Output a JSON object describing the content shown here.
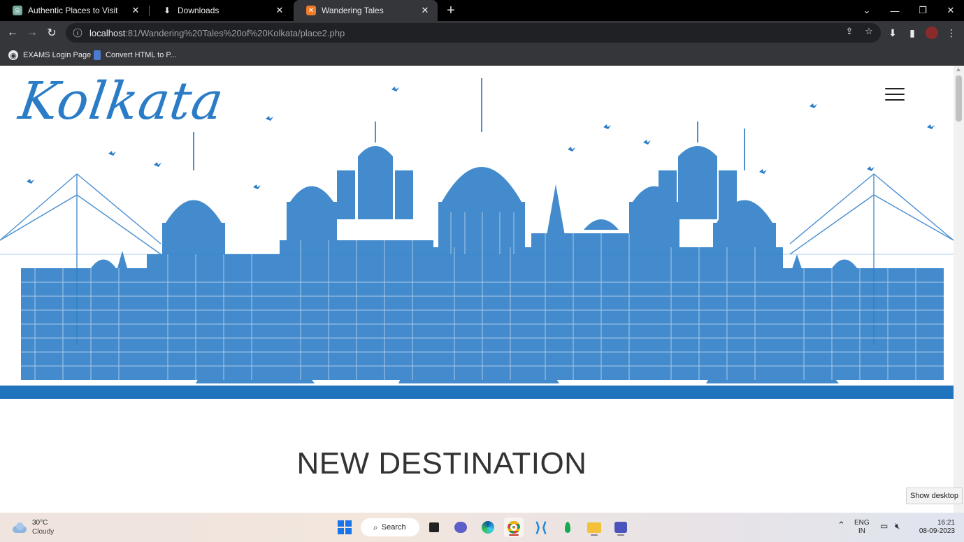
{
  "browser": {
    "tabs": [
      {
        "title": "Authentic Places to Visit",
        "icon": "gpt-icon",
        "active": false
      },
      {
        "title": "Downloads",
        "icon": "download-icon",
        "active": false
      },
      {
        "title": "Wandering Tales",
        "icon": "xampp-icon",
        "active": true
      }
    ],
    "url_host": "localhost",
    "url_rest": ":81/Wandering%20Tales%20of%20Kolkata/place2.php",
    "bookmarks": [
      {
        "label": "EXAMS Login Page",
        "icon": "globe-icon"
      },
      {
        "label": "Convert HTML to P...",
        "icon": "document-icon"
      }
    ]
  },
  "page": {
    "logo": "Kolkata",
    "heading": "NEW DESTINATION",
    "colors": {
      "skyline": "#2a7cc7",
      "band": "#1f74bd",
      "heading": "#333333"
    }
  },
  "system": {
    "tooltip": "Show desktop",
    "weather_temp": "30°C",
    "weather_cond": "Cloudy",
    "search_label": "Search",
    "lang_top": "ENG",
    "lang_bottom": "IN",
    "time": "16:21",
    "date": "08-09-2023"
  }
}
